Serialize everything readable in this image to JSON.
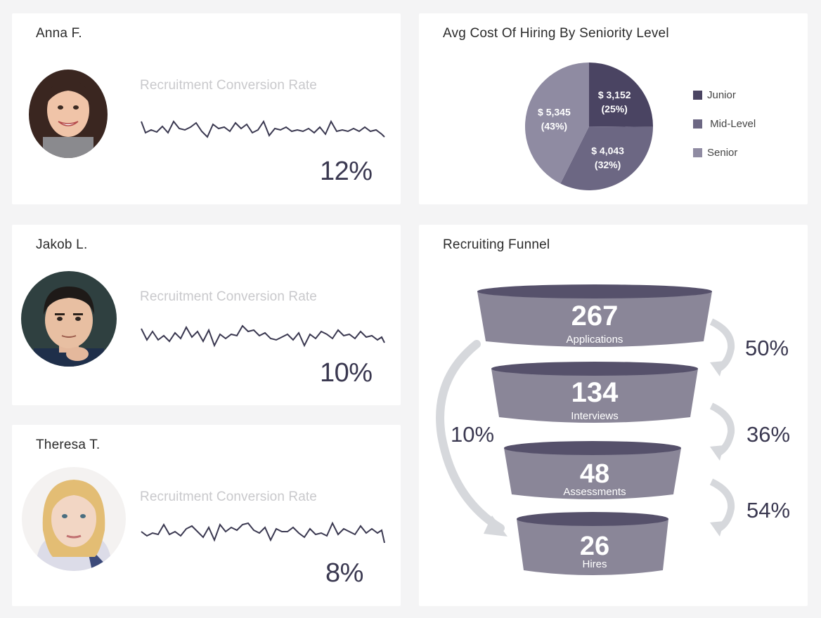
{
  "people": [
    {
      "name": "Anna F.",
      "metric_label": "Recruitment Conversion Rate",
      "value": "12%",
      "photo_icon": "woman-brunette-portrait-icon"
    },
    {
      "name": "Jakob L.",
      "metric_label": "Recruitment Conversion Rate",
      "value": "10%",
      "photo_icon": "man-dark-hair-portrait-icon"
    },
    {
      "name": "Theresa T.",
      "metric_label": "Recruitment Conversion Rate",
      "value": "8%",
      "photo_icon": "woman-blonde-portrait-icon"
    }
  ],
  "pie": {
    "title": "Avg Cost Of Hiring By Seniority Level",
    "slices": [
      {
        "name": "Junior",
        "label": "Junior",
        "amount": "$ 3,152",
        "percent": "(25%)",
        "value": 3152,
        "color": "#4a4462"
      },
      {
        "name": "Mid-Level",
        "label": " Mid-Level",
        "amount": "$ 4,043",
        "percent": "(32%)",
        "value": 4043,
        "color": "#6c6783"
      },
      {
        "name": "Senior",
        "label": "Senior",
        "amount": "$ 5,345",
        "percent": "(43%)",
        "value": 5345,
        "color": "#8f8ba2"
      }
    ]
  },
  "funnel": {
    "title": "Recruiting Funnel",
    "stages": [
      {
        "number": "267",
        "label": "Applications"
      },
      {
        "number": "134",
        "label": "Interviews"
      },
      {
        "number": "48",
        "label": "Assessments"
      },
      {
        "number": "26",
        "label": "Hires"
      }
    ],
    "step_rates": [
      "50%",
      "36%",
      "54%"
    ],
    "overall_rate": "10%"
  },
  "colors": {
    "accent": "#3a3850",
    "funnel_body": "#8a8698",
    "funnel_top": "#56516b",
    "arrow": "#d6d8dc"
  }
}
